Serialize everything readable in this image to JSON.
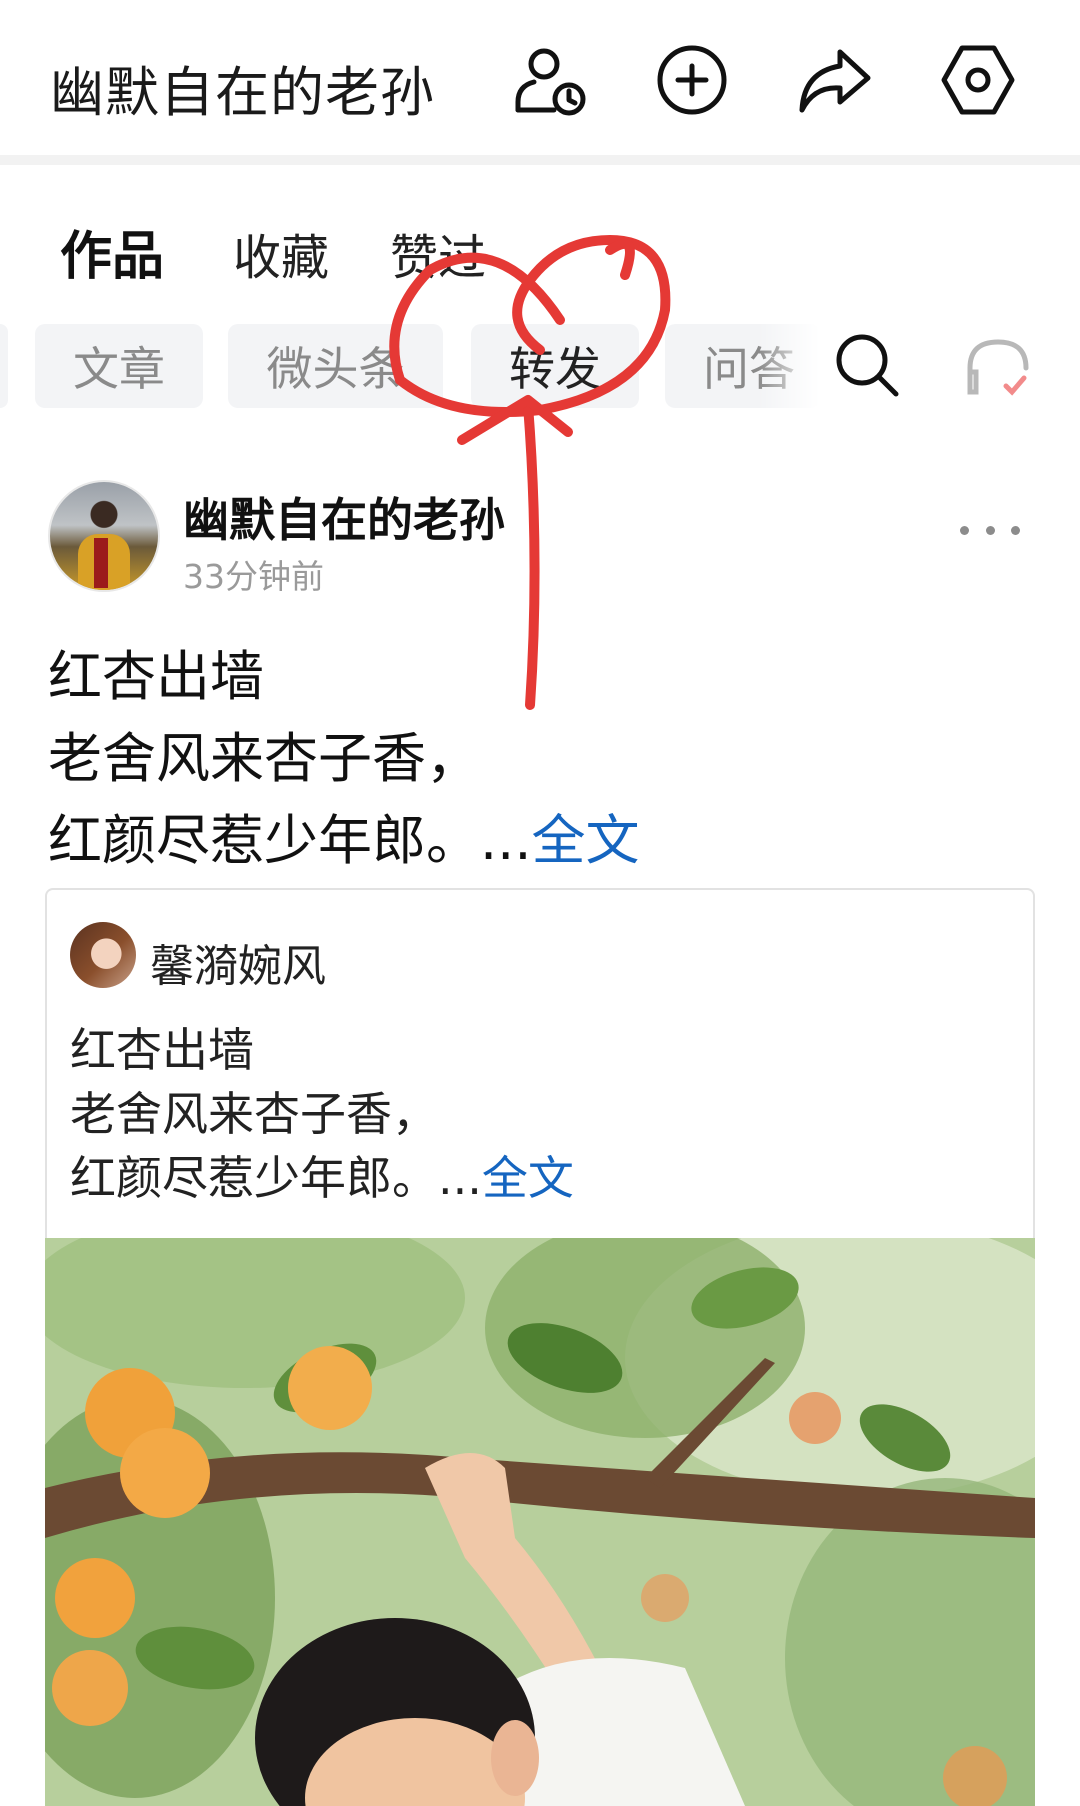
{
  "header": {
    "title": "幽默自在的老孙",
    "icons": [
      "user-clock-icon",
      "plus-circle-icon",
      "share-arrow-icon",
      "settings-hexagon-icon"
    ]
  },
  "main_tabs": [
    {
      "label": "作品",
      "active": true
    },
    {
      "label": "收藏",
      "active": false
    },
    {
      "label": "赞过",
      "active": false
    }
  ],
  "sub_tabs": [
    {
      "label": "文章",
      "active": false
    },
    {
      "label": "微头条",
      "active": false
    },
    {
      "label": "转发",
      "active": true
    },
    {
      "label": "问答",
      "active": false
    }
  ],
  "post": {
    "author": "幽默自在的老孙",
    "time": "33分钟前",
    "text": "红杏出墙\n老舍风来杏子香，\n红颜尽惹少年郎。...",
    "full_label": "全文"
  },
  "quoted": {
    "author": "馨漪婉风",
    "text": "红杏出墙\n老舍风来杏子香，\n红颜尽惹少年郎。...",
    "full_label": "全文"
  },
  "colors": {
    "link": "#1565c0",
    "annotation": "#e53935",
    "chip_bg": "#f3f4f6"
  }
}
